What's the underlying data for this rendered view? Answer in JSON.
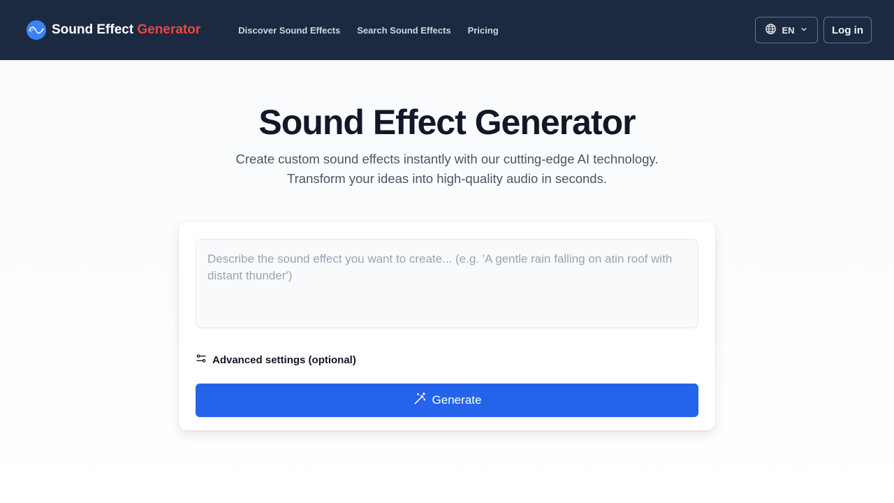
{
  "header": {
    "brand": {
      "text_main": "Sound Effect",
      "text_accent": "Generator",
      "logo_icon": "waveform-icon"
    },
    "nav": [
      {
        "label": "Discover Sound Effects"
      },
      {
        "label": "Search Sound Effects"
      },
      {
        "label": "Pricing"
      }
    ],
    "language": {
      "label": "EN",
      "icon": "globe-icon"
    },
    "login_label": "Log in"
  },
  "hero": {
    "title": "Sound Effect Generator",
    "subtitle_line1": "Create custom sound effects instantly with our cutting-edge AI technology.",
    "subtitle_line2": "Transform your ideas into high-quality audio in seconds."
  },
  "generator": {
    "prompt_value": "",
    "prompt_placeholder": "Describe the sound effect you want to create... (e.g. 'A gentle rain falling on atin roof with distant thunder')",
    "advanced_label": "Advanced settings (optional)",
    "generate_label": "Generate"
  },
  "colors": {
    "header_bg": "#1b2a41",
    "brand_accent": "#ef4444",
    "primary": "#2563eb"
  }
}
